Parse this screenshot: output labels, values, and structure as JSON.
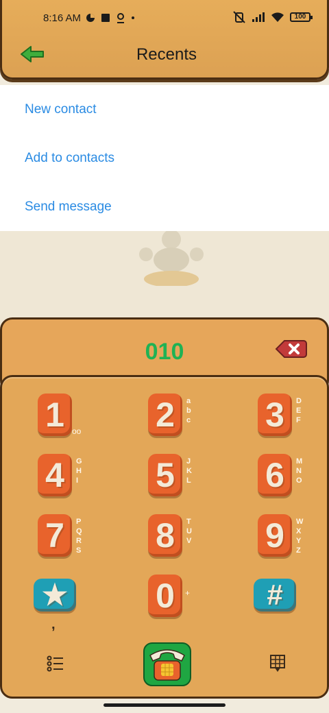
{
  "status_bar": {
    "time": "8:16 AM",
    "battery": "100"
  },
  "header": {
    "title": "Recents",
    "back_icon": "green-arrow-left-icon"
  },
  "menu": {
    "items": [
      {
        "label": "New contact"
      },
      {
        "label": "Add to contacts"
      },
      {
        "label": "Send message"
      }
    ]
  },
  "dialer": {
    "number": "010",
    "delete_icon": "backspace-icon",
    "keys": [
      {
        "digit": "1",
        "letters": "",
        "sub": "oo"
      },
      {
        "digit": "2",
        "letters": "abc",
        "sub": ""
      },
      {
        "digit": "3",
        "letters": "DEF",
        "sub": ""
      },
      {
        "digit": "4",
        "letters": "GHI",
        "sub": ""
      },
      {
        "digit": "5",
        "letters": "JKL",
        "sub": ""
      },
      {
        "digit": "6",
        "letters": "MNO",
        "sub": ""
      },
      {
        "digit": "7",
        "letters": "PQRS",
        "sub": ""
      },
      {
        "digit": "8",
        "letters": "TUV",
        "sub": ""
      },
      {
        "digit": "9",
        "letters": "WXYZ",
        "sub": ""
      },
      {
        "digit": "★",
        "letters": "",
        "sub": ","
      },
      {
        "digit": "0",
        "letters": "",
        "sub": "+"
      },
      {
        "digit": "#",
        "letters": "",
        "sub": ""
      }
    ],
    "bottom": {
      "menu_icon": "list-icon",
      "call_icon": "telephone-icon",
      "keypad_icon": "keypad-icon"
    }
  },
  "colors": {
    "accent_blue": "#2a8be3",
    "number_green": "#1fb254",
    "panel_orange": "#e3a758",
    "key_orange": "#e8632c",
    "key_teal": "#1f9fb5"
  }
}
